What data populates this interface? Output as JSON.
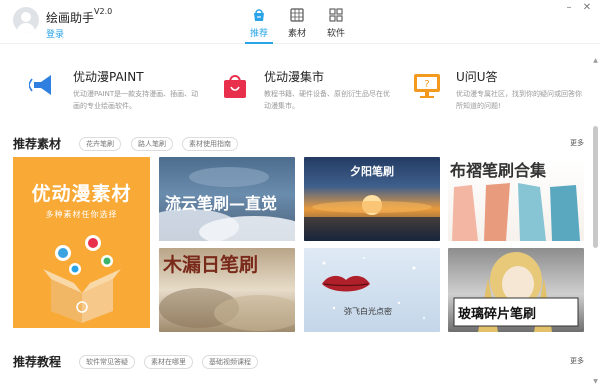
{
  "header": {
    "title": "绘画助手",
    "version": "V2.0",
    "login": "登录",
    "tabs": [
      {
        "label": "推荐",
        "icon": "recommend-icon",
        "active": true
      },
      {
        "label": "素材",
        "icon": "material-icon",
        "active": false
      },
      {
        "label": "软件",
        "icon": "software-icon",
        "active": false
      }
    ],
    "window_controls": {
      "minimize": "–",
      "close": "✕"
    }
  },
  "products": [
    {
      "name": "优动漫PAINT",
      "desc": "优动漫PAINT是一款支持漫画、插画、动画的专业绘画软件。",
      "icon": "megaphone-icon",
      "color": "#2f7fe0"
    },
    {
      "name": "优动漫集市",
      "desc": "教程书籍、硬件设备、原创衍生品尽在优动漫集市。",
      "icon": "shopping-bag-icon",
      "color": "#e8304c"
    },
    {
      "name": "U问U答",
      "desc": "优动漫专属社区，找到你的疑问或回答你所知道的问题!",
      "icon": "qa-monitor-icon",
      "color": "#f39a1e"
    }
  ],
  "materials": {
    "title": "推荐素材",
    "tags": [
      "花卉笔刷",
      "路人笔刷",
      "素材使用指南"
    ],
    "more": "更多",
    "featured": {
      "title": "优动漫素材",
      "subtitle": "多种素材任你选择"
    },
    "cards": [
      {
        "text": "流云笔刷—直觉"
      },
      {
        "text": "夕阳笔刷"
      },
      {
        "text": "布褶笔刷合集"
      },
      {
        "text": "木漏日笔刷"
      },
      {
        "text": "弥飞白光点密"
      },
      {
        "text": "玻璃碎片笔刷"
      }
    ]
  },
  "tutorials": {
    "title": "推荐教程",
    "tags": [
      "软件常见答疑",
      "素材在哪里",
      "基础视频课程"
    ],
    "more": "更多"
  }
}
